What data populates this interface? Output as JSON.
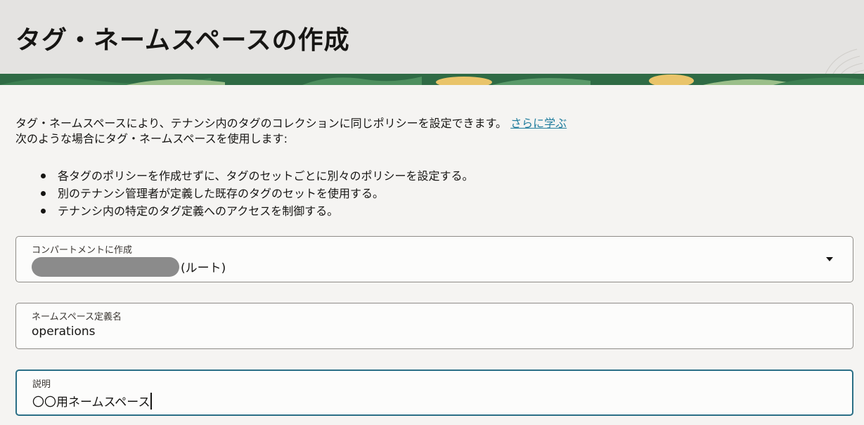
{
  "header": {
    "title": "タグ・ネームスペースの作成"
  },
  "intro": {
    "line1": "タグ・ネームスペースにより、テナンシ内のタグのコレクションに同じポリシーを設定できます。",
    "learn_more": "さらに学ぶ",
    "line2": "次のような場合にタグ・ネームスペースを使用します:"
  },
  "bullets": [
    "各タグのポリシーを作成せずに、タグのセットごとに別々のポリシーを設定する。",
    "別のテナンシ管理者が定義した既存のタグのセットを使用する。",
    "テナンシ内の特定のタグ定義へのアクセスを制御する。"
  ],
  "compartment": {
    "label": "コンパートメントに作成",
    "value_suffix": "(ルート)"
  },
  "namespace": {
    "label": "ネームスペース定義名",
    "value": "operations"
  },
  "description": {
    "label": "説明",
    "value": "〇〇用ネームスペース"
  },
  "colors": {
    "accent": "#227e9e",
    "focus_border": "#2a6f86",
    "banner_green": "#2f6b45"
  }
}
